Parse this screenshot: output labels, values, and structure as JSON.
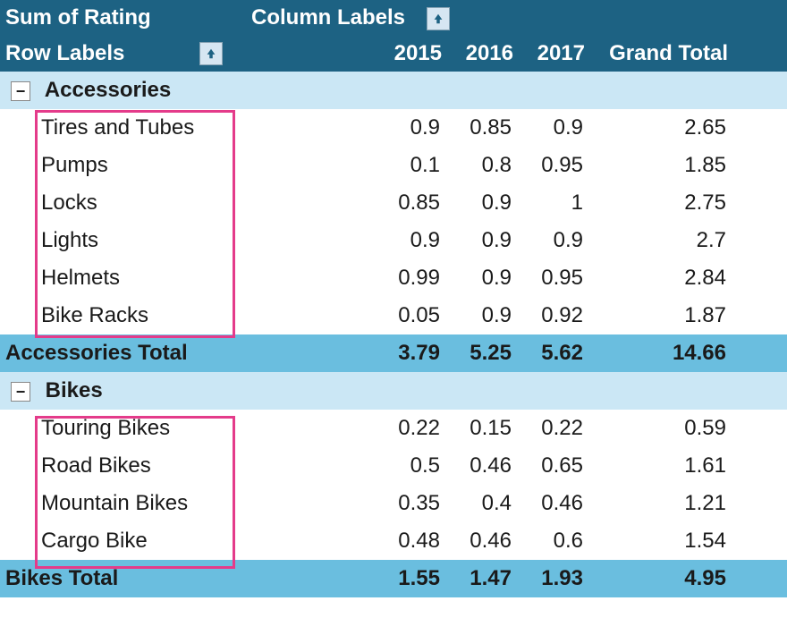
{
  "header": {
    "measure_title": "Sum of Rating",
    "column_labels_title": "Column Labels",
    "row_labels_title": "Row Labels",
    "years": [
      "2015",
      "2016",
      "2017"
    ],
    "grand_total_label": "Grand Total"
  },
  "groups": [
    {
      "name": "Accessories",
      "total_label": "Accessories Total",
      "items": [
        {
          "label": "Tires and Tubes",
          "y2015": "0.9",
          "y2016": "0.85",
          "y2017": "0.9",
          "gt": "2.65"
        },
        {
          "label": "Pumps",
          "y2015": "0.1",
          "y2016": "0.8",
          "y2017": "0.95",
          "gt": "1.85"
        },
        {
          "label": "Locks",
          "y2015": "0.85",
          "y2016": "0.9",
          "y2017": "1",
          "gt": "2.75"
        },
        {
          "label": "Lights",
          "y2015": "0.9",
          "y2016": "0.9",
          "y2017": "0.9",
          "gt": "2.7"
        },
        {
          "label": "Helmets",
          "y2015": "0.99",
          "y2016": "0.9",
          "y2017": "0.95",
          "gt": "2.84"
        },
        {
          "label": "Bike Racks",
          "y2015": "0.05",
          "y2016": "0.9",
          "y2017": "0.92",
          "gt": "1.87"
        }
      ],
      "total": {
        "y2015": "3.79",
        "y2016": "5.25",
        "y2017": "5.62",
        "gt": "14.66"
      }
    },
    {
      "name": "Bikes",
      "total_label": "Bikes Total",
      "items": [
        {
          "label": "Touring Bikes",
          "y2015": "0.22",
          "y2016": "0.15",
          "y2017": "0.22",
          "gt": "0.59"
        },
        {
          "label": "Road Bikes",
          "y2015": "0.5",
          "y2016": "0.46",
          "y2017": "0.65",
          "gt": "1.61"
        },
        {
          "label": "Mountain Bikes",
          "y2015": "0.35",
          "y2016": "0.4",
          "y2017": "0.46",
          "gt": "1.21"
        },
        {
          "label": "Cargo Bike",
          "y2015": "0.48",
          "y2016": "0.46",
          "y2017": "0.6",
          "gt": "1.54"
        }
      ],
      "total": {
        "y2015": "1.55",
        "y2016": "1.47",
        "y2017": "1.93",
        "gt": "4.95"
      }
    }
  ],
  "colors": {
    "header_bg": "#1d6283",
    "group_bg": "#cbe7f5",
    "total_bg": "#6abedf",
    "highlight": "#e43b8a"
  }
}
